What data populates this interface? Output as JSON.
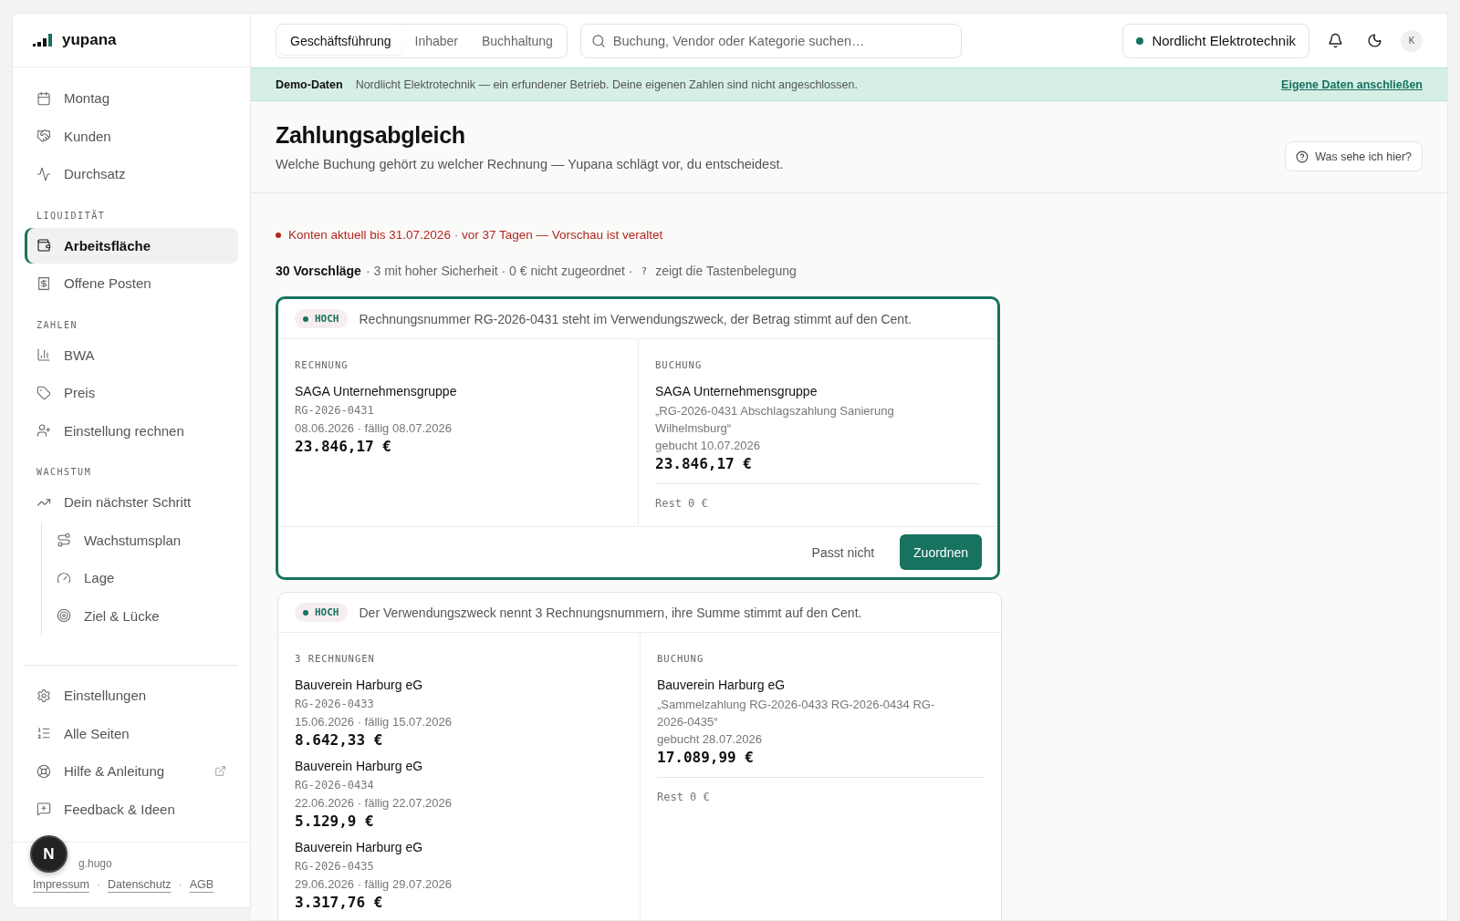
{
  "sidebar": {
    "logo": "yupana",
    "groups": [
      {
        "items": [
          {
            "label": "Montag",
            "selected": false
          },
          {
            "label": "Kunden",
            "selected": false
          },
          {
            "label": "Durchsatz",
            "selected": false
          }
        ]
      },
      {
        "heading": "LIQUIDITÄT",
        "items": [
          {
            "label": "Arbeitsfläche",
            "selected": true
          },
          {
            "label": "Offene Posten",
            "selected": false
          }
        ]
      },
      {
        "heading": "ZAHLEN",
        "items": [
          {
            "label": "BWA",
            "selected": false
          },
          {
            "label": "Preis",
            "selected": false
          },
          {
            "label": "Einstellung rechnen",
            "selected": false
          }
        ]
      },
      {
        "heading": "WACHSTUM",
        "items": [
          {
            "label": "Dein nächster Schritt",
            "selected": false,
            "children": [
              {
                "label": "Wachstumsplan",
                "selected": false
              },
              {
                "label": "Lage",
                "selected": false
              },
              {
                "label": "Ziel & Lücke",
                "selected": false
              }
            ]
          }
        ]
      }
    ],
    "bottom_items": [
      {
        "label": "Einstellungen",
        "external": false
      },
      {
        "label": "Alle Seiten",
        "external": false
      },
      {
        "label": "Hilfe & Anleitung",
        "external": true
      },
      {
        "label": "Feedback & Ideen",
        "external": false
      }
    ],
    "credit": "g.hugo",
    "footer_links": [
      "Impressum",
      "Datenschutz",
      "AGB"
    ],
    "footer_separator": "·"
  },
  "dev_badge": "N",
  "topbar": {
    "tabs": [
      {
        "label": "Geschäftsführung",
        "selected": true
      },
      {
        "label": "Inhaber",
        "selected": false
      },
      {
        "label": "Buchhaltung",
        "selected": false
      }
    ],
    "search": {
      "placeholder": "Buchung, Vendor oder Kategorie suchen…"
    },
    "company": "Nordlicht Elektrotechnik",
    "avatar": "K"
  },
  "banner": {
    "label": "Demo-Daten",
    "text": "Nordlicht Elektrotechnik — ein erfundener Betrieb. Deine eigenen Zahlen sind nicht angeschlossen.",
    "link": "Eigene Daten anschließen"
  },
  "header": {
    "title": "Zahlungsabgleich",
    "subtitle": "Welche Buchung gehört zu welcher Rechnung — Yupana schlägt vor, du entscheidest.",
    "help_button": "Was sehe ich hier?"
  },
  "alert": "Konten aktuell bis 31.07.2026 · vor 37 Tagen — Vorschau ist veraltet",
  "summary": {
    "count": "30 Vorschläge",
    "details": "· 3 mit hoher Sicherheit · 0 € nicht zugeordnet ·",
    "key": "?",
    "key_hint": "zeigt die Tastenbelegung"
  },
  "cards": [
    {
      "selected": true,
      "confidence": "HOCH",
      "reason": "Rechnungsnummer RG-2026-0431 steht im Verwendungszweck, der Betrag stimmt auf den Cent.",
      "invoices_heading": "RECHNUNG",
      "invoices": [
        {
          "name": "SAGA Unternehmensgruppe",
          "number": "RG-2026-0431",
          "dates": "08.06.2026 · fällig 08.07.2026",
          "amount": "23.846,17 €"
        }
      ],
      "booking": {
        "heading": "BUCHUNG",
        "name": "SAGA Unternehmensgruppe",
        "purpose": "„RG-2026-0431 Abschlagszahlung Sanierung Wilhelmsburg“",
        "booked": "gebucht 10.07.2026",
        "amount": "23.846,17 €",
        "rest": "Rest 0 €"
      },
      "actions": {
        "reject": "Passt nicht",
        "accept": "Zuordnen"
      }
    },
    {
      "selected": false,
      "confidence": "HOCH",
      "reason": "Der Verwendungszweck nennt 3 Rechnungsnummern, ihre Summe stimmt auf den Cent.",
      "invoices_heading": "3 RECHNUNGEN",
      "invoices": [
        {
          "name": "Bauverein Harburg eG",
          "number": "RG-2026-0433",
          "dates": "15.06.2026 · fällig 15.07.2026",
          "amount": "8.642,33 €"
        },
        {
          "name": "Bauverein Harburg eG",
          "number": "RG-2026-0434",
          "dates": "22.06.2026 · fällig 22.07.2026",
          "amount": "5.129,9 €"
        },
        {
          "name": "Bauverein Harburg eG",
          "number": "RG-2026-0435",
          "dates": "29.06.2026 · fällig 29.07.2026",
          "amount": "3.317,76 €"
        }
      ],
      "booking": {
        "heading": "BUCHUNG",
        "name": "Bauverein Harburg eG",
        "purpose": "„Sammelzahlung RG-2026-0433 RG-2026-0434 RG-2026-0435“",
        "booked": "gebucht 28.07.2026",
        "amount": "17.089,99 €",
        "rest": "Rest 0 €"
      }
    }
  ]
}
